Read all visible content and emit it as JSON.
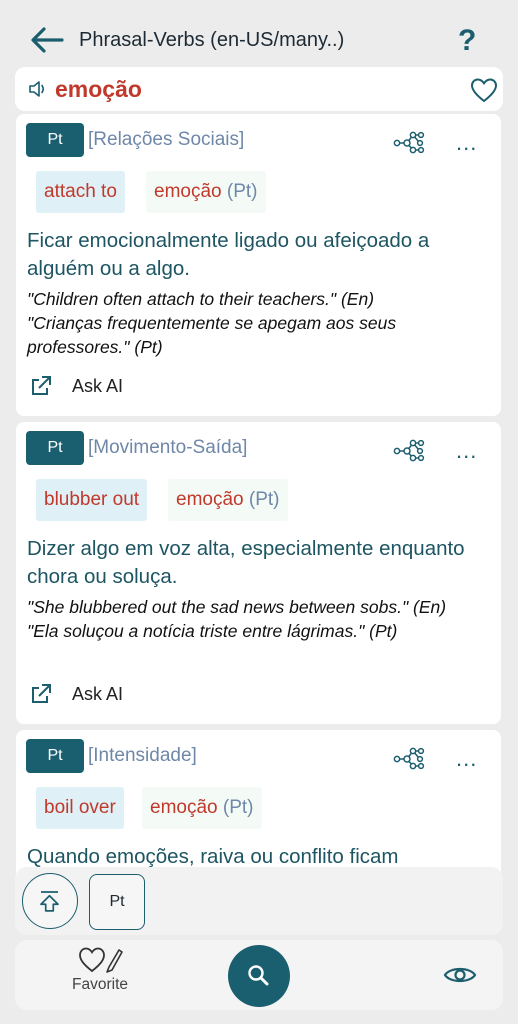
{
  "header": {
    "title": "Phrasal-Verbs (en-US/many..)",
    "help_label": "?"
  },
  "search": {
    "word": "emoção"
  },
  "entries": [
    {
      "lang_badge": "Pt",
      "category": "[Relações Sociais]",
      "phrasal_verb": "attach to",
      "translation": "emoção",
      "translation_lang": "(Pt)",
      "definition": "Ficar emocionalmente ligado ou afeiçoado a alguém ou a algo.",
      "example_en": "\"Children often attach to their teachers.\" (En)",
      "example_pt": "\"Crianças frequentemente se apegam aos seus professores.\" (Pt)",
      "ask_ai_label": "Ask AI",
      "more_label": "..."
    },
    {
      "lang_badge": "Pt",
      "category": "[Movimento-Saída]",
      "phrasal_verb": "blubber out",
      "translation": "emoção",
      "translation_lang": "(Pt)",
      "definition": "Dizer algo em voz alta, especialmente enquanto chora ou soluça.",
      "example_en": "\"She blubbered out the sad news between sobs.\" (En)",
      "example_pt": "\"Ela soluçou a notícia triste entre lágrimas.\" (Pt)",
      "ask_ai_label": "Ask AI",
      "more_label": "..."
    },
    {
      "lang_badge": "Pt",
      "category": "[Intensidade]",
      "phrasal_verb": "boil over",
      "translation": "emoção",
      "translation_lang": "(Pt)",
      "definition": "Quando emoções, raiva ou conflito ficam",
      "more_label": "..."
    }
  ],
  "float_actions": {
    "lang_button": "Pt"
  },
  "bottom_nav": {
    "favorite_label": "Favorite"
  },
  "colors": {
    "accent": "#1a5f70",
    "verb_red": "#c0392b",
    "category_blue": "#6f87a8"
  }
}
